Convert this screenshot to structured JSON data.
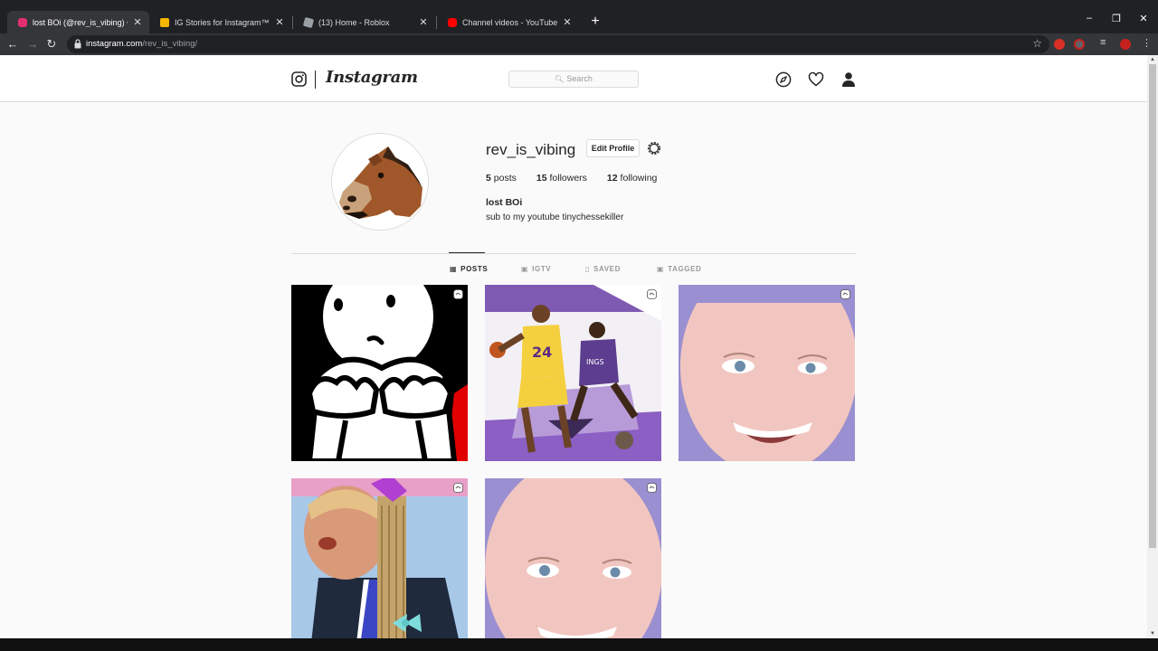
{
  "browser": {
    "tabs": [
      {
        "title": "lost BOi (@rev_is_vibing) • Instagram",
        "favicon_color": "#e1306c",
        "active": true
      },
      {
        "title": "IG Stories for Instagram™ - Chrome",
        "favicon_color": "#f4b400",
        "active": false
      },
      {
        "title": "(13) Home - Roblox",
        "favicon_color": "#9aa0a6",
        "active": false
      },
      {
        "title": "Channel videos - YouTube Studio",
        "favicon_color": "#ff0000",
        "active": false
      }
    ],
    "close_glyph": "✕",
    "newtab_glyph": "+",
    "url_host": "instagram.com",
    "url_path": "/rev_is_vibing/"
  },
  "instagram": {
    "wordmark": "Instagram",
    "search_placeholder": "Search",
    "profile": {
      "username": "rev_is_vibing",
      "edit_label": "Edit Profile",
      "posts_count": "5",
      "posts_label": "posts",
      "followers_count": "15",
      "followers_label": "followers",
      "following_count": "12",
      "following_label": "following",
      "full_name": "lost BOi",
      "bio": "sub to my youtube tinychessekiller"
    },
    "tabs": [
      {
        "label": "POSTS",
        "icon": "grid-icon",
        "active": true
      },
      {
        "label": "IGTV",
        "icon": "igtv-icon",
        "active": false
      },
      {
        "label": "SAVED",
        "icon": "bookmark-icon",
        "active": false
      },
      {
        "label": "TAGGED",
        "icon": "tagged-icon",
        "active": false
      }
    ],
    "posts": [
      {
        "subject": "cartoon-stick-figure-sitting"
      },
      {
        "subject": "basketball-players"
      },
      {
        "subject": "smiling-face-close-up"
      },
      {
        "subject": "man-with-braids-and-bows"
      },
      {
        "subject": "smiling-face-close-up"
      }
    ]
  },
  "colors": {
    "ig_text": "#262626",
    "ig_border": "#dbdbdb",
    "chrome_dark": "#202124",
    "chrome_toolbar": "#35363a"
  }
}
